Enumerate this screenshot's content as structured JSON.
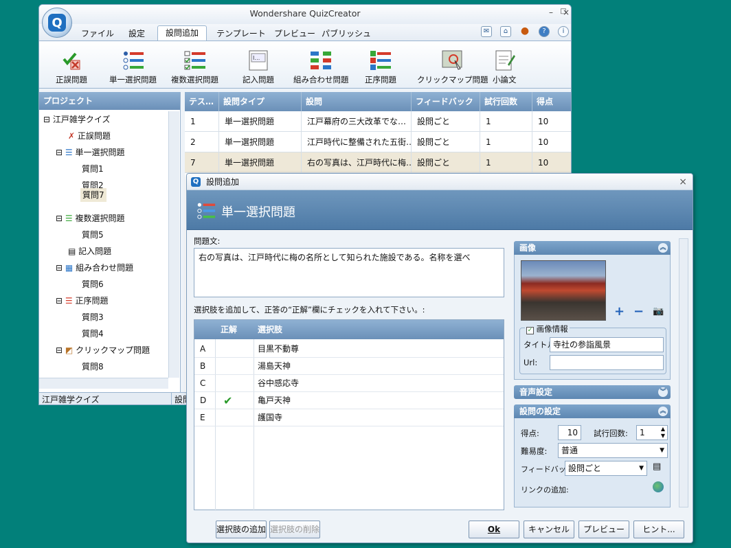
{
  "app": {
    "title": "Wondershare QuizCreator",
    "logo_letter": "Q"
  },
  "window_controls": {
    "minimize": "–",
    "maximize": "□",
    "close": "×"
  },
  "tabs": [
    "ファイル",
    "設定",
    "設問追加",
    "テンプレート",
    "プレビュー",
    "パブリッシュ"
  ],
  "active_tab": "設問追加",
  "ribbon": [
    "正誤問題",
    "単一選択問題",
    "複数選択問題",
    "記入問題",
    "組み合わせ問題",
    "正序問題",
    "クリックマップ問題",
    "小論文"
  ],
  "project": {
    "header": "プロジェクト",
    "root": "江戸雑学クイズ",
    "nodes": [
      {
        "label": "正誤問題",
        "level": 1,
        "icon": "true-false-icon"
      },
      {
        "label": "単一選択問題",
        "level": 1,
        "icon": "single-choice-icon"
      },
      {
        "label": "質問1",
        "level": 2
      },
      {
        "label": "質問2",
        "level": 2
      },
      {
        "label": "質問7",
        "level": 2,
        "selected": true
      },
      {
        "label": "複数選択問題",
        "level": 1,
        "icon": "multi-choice-icon"
      },
      {
        "label": "質問5",
        "level": 2
      },
      {
        "label": "記入問題",
        "level": 1,
        "icon": "fill-in-icon"
      },
      {
        "label": "組み合わせ問題",
        "level": 1,
        "icon": "matching-icon"
      },
      {
        "label": "質問6",
        "level": 2
      },
      {
        "label": "正序問題",
        "level": 1,
        "icon": "sequence-icon"
      },
      {
        "label": "質問3",
        "level": 2
      },
      {
        "label": "質問4",
        "level": 2
      },
      {
        "label": "クリックマップ問題",
        "level": 1,
        "icon": "click-map-icon"
      },
      {
        "label": "質問8",
        "level": 2
      }
    ]
  },
  "status": {
    "left": "江戸雑学クイズ",
    "right": "設問"
  },
  "grid": {
    "headers": [
      "テス…",
      "設問タイプ",
      "設問",
      "フィードバック",
      "試行回数",
      "得点"
    ],
    "rows": [
      [
        "1",
        "単一選択問題",
        "江戸幕府の三大改革でな…",
        "設問ごと",
        "1",
        "10"
      ],
      [
        "2",
        "単一選択問題",
        "江戸時代に整備された五街…",
        "設問ごと",
        "1",
        "10"
      ],
      [
        "7",
        "単一選択問題",
        "右の写真は、江戸時代に梅…",
        "設問ごと",
        "1",
        "10"
      ]
    ]
  },
  "dialog": {
    "title": "設問追加",
    "heading": "単一選択問題",
    "question_label": "問題文:",
    "question_text": "右の写真は、江戸時代に梅の名所として知られた施設である。名称を選べ",
    "instruction": "選択肢を追加して、正答の“正解”欄にチェックを入れて下さい。:",
    "choice_headers": {
      "correct": "正解",
      "choice": "選択肢"
    },
    "choices": [
      {
        "key": "A",
        "text": "目黒不動尊",
        "correct": false
      },
      {
        "key": "B",
        "text": "湯島天神",
        "correct": false
      },
      {
        "key": "C",
        "text": "谷中感応寺",
        "correct": false
      },
      {
        "key": "D",
        "text": "亀戸天神",
        "correct": true
      },
      {
        "key": "E",
        "text": "護国寺",
        "correct": false
      }
    ],
    "image_section": "画像",
    "image_info_label": "画像情報",
    "title_label": "タイトル:",
    "title_value": "寺社の参詣風景",
    "url_label": "Url:",
    "url_value": "",
    "sound_section": "音声設定",
    "settings_section": "設問の設定",
    "score_label": "得点:",
    "score_value": "10",
    "attempts_label": "試行回数:",
    "attempts_value": "1",
    "difficulty_label": "難易度:",
    "difficulty_value": "普通",
    "feedback_label": "フィードバック:",
    "feedback_value": "設問ごと",
    "link_label": "リンクの追加:",
    "buttons": {
      "add_choice": "選択肢の追加",
      "delete_choice": "選択肢の削除",
      "ok": "Ok",
      "cancel": "キャンセル",
      "preview": "プレビュー",
      "hint": "ヒント..."
    }
  }
}
